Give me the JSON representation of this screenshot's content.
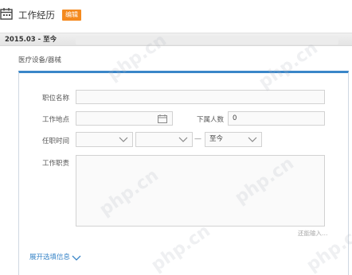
{
  "section": {
    "title": "工作经历",
    "edit_label": "编辑"
  },
  "period": {
    "text": "2015.03 - 至今"
  },
  "company": {
    "industry": "医疗设备/器械"
  },
  "form": {
    "position_name": {
      "label": "职位名称",
      "value": ""
    },
    "work_location": {
      "label": "工作地点",
      "value": ""
    },
    "subordinates": {
      "label": "下属人数",
      "value": "0"
    },
    "tenure": {
      "label": "任职时间",
      "start_year": "",
      "start_month": "",
      "separator": "—",
      "end_value": "至今"
    },
    "duties": {
      "label": "工作职责",
      "value": ""
    },
    "char_limit_text": "还能输入…",
    "expand_label": "展开选填信息"
  },
  "icons": {
    "section": "calendar-icon",
    "location": "date-picker-icon",
    "dropdown": "chevron-down-icon",
    "expand": "chevron-down-icon"
  },
  "colors": {
    "accent": "#3a86c8",
    "badge": "#f48a1f"
  },
  "watermark": "php.cn"
}
